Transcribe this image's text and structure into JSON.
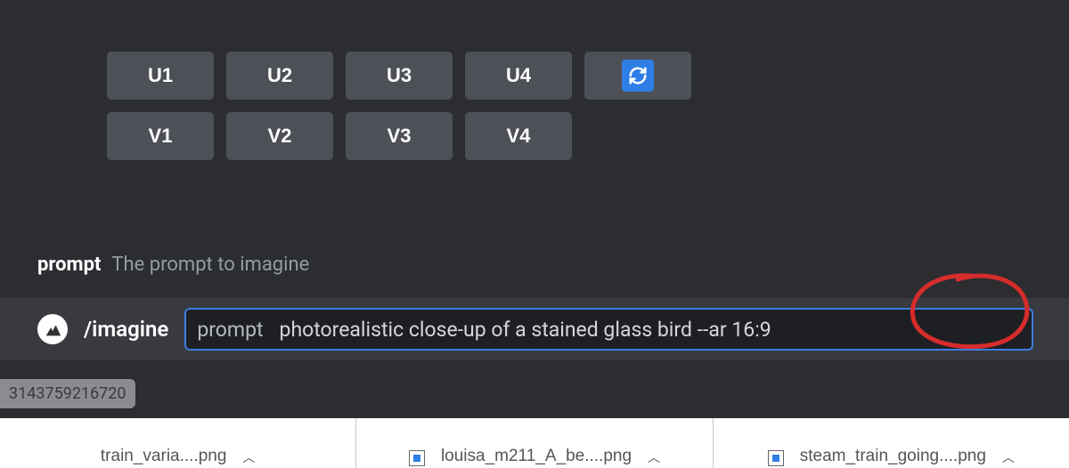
{
  "buttons": {
    "row1": [
      "U1",
      "U2",
      "U3",
      "U4"
    ],
    "row2": [
      "V1",
      "V2",
      "V3",
      "V4"
    ],
    "refresh_icon": "refresh-icon"
  },
  "param_hint": {
    "label": "prompt",
    "description": "The prompt to imagine"
  },
  "input": {
    "command": "/imagine",
    "param_label": "prompt",
    "value": "photorealistic close-up of a stained glass bird --ar 16:9"
  },
  "thread_id": "3143759216720",
  "files": [
    {
      "name": "train_varia....png"
    },
    {
      "name": "louisa_m211_A_be....png"
    },
    {
      "name": "steam_train_going....png"
    }
  ],
  "annotation": {
    "highlighted_text": "--ar 16:9",
    "color": "#d62c2c"
  }
}
